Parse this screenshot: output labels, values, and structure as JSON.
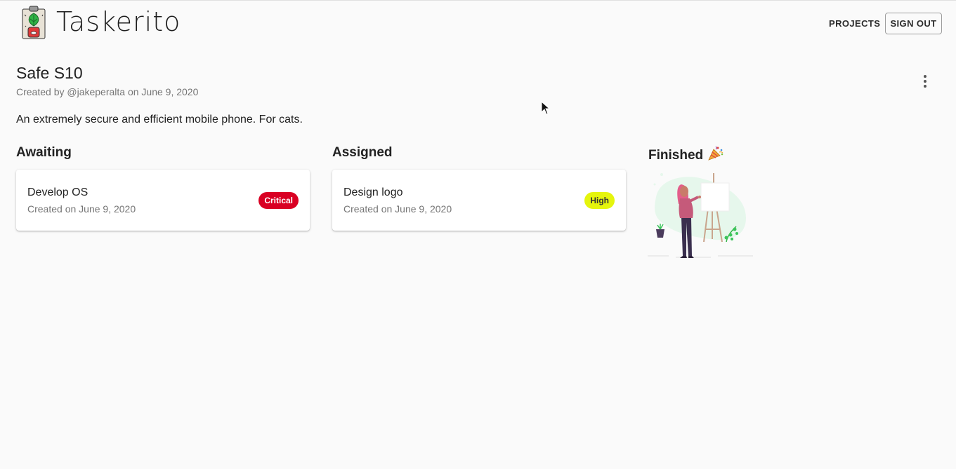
{
  "app": {
    "name": "Taskerito"
  },
  "nav": {
    "projects_label": "PROJECTS",
    "signout_label": "SIGN OUT"
  },
  "project": {
    "title": "Safe S10",
    "meta": "Created by @jakeperalta on June 9, 2020",
    "description": "An extremely secure and efficient mobile phone. For cats."
  },
  "columns": [
    {
      "title": "Awaiting",
      "tasks": [
        {
          "title": "Develop OS",
          "date": "Created on June 9, 2020",
          "priority": "Critical",
          "priority_color": "#d90023"
        }
      ]
    },
    {
      "title": "Assigned",
      "tasks": [
        {
          "title": "Design logo",
          "date": "Created on June 9, 2020",
          "priority": "High",
          "priority_color": "#e5f50d"
        }
      ]
    },
    {
      "title": "Finished",
      "title_icon": "party-popper-icon",
      "empty_illustration": "woman-painting-easel-illustration",
      "tasks": []
    }
  ]
}
